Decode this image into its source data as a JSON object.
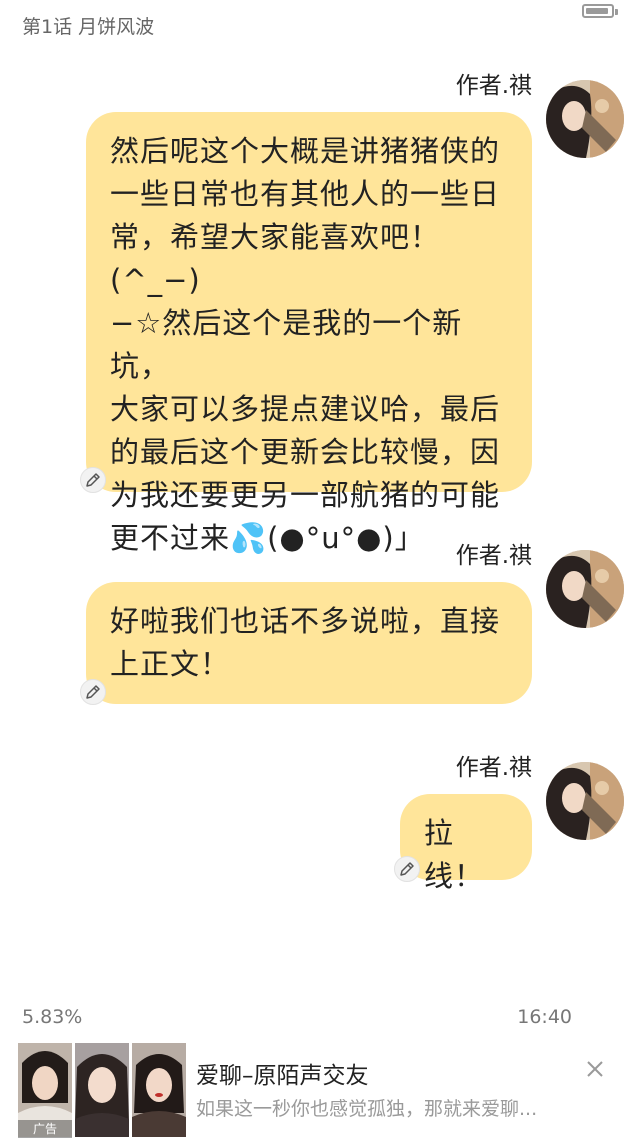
{
  "chapter": {
    "title": "第1话 月饼风波"
  },
  "messages": [
    {
      "author": "作者.祺",
      "lines": [
        "然后呢这个大概是讲猪猪侠的",
        "一些日常也有其他人的一些日",
        "常，希望大家能喜欢吧！(^_−)",
        "−☆然后这个是我的一个新坑，",
        "大家可以多提点建议哈，最后",
        "的最后这个更新会比较慢，因",
        "为我还要更另一部航猪的可能",
        "更不过来💦(●°u°●)」"
      ]
    },
    {
      "author": "作者.祺",
      "lines": [
        "好啦我们也话不多说啦，直接",
        "上正文！"
      ]
    },
    {
      "author": "作者.祺",
      "lines": [
        "拉线！"
      ]
    }
  ],
  "status": {
    "progress": "5.83%",
    "time": "16:40",
    "battery_level": 0.9
  },
  "ad": {
    "title": "爱聊–原陌声交友",
    "description": "如果这一秒你也感觉孤独，那就来爱聊...",
    "tag": "广告"
  },
  "colors": {
    "bubble": "#ffe59a",
    "page_background": "#ffffff"
  },
  "icons": {
    "edit": "pencil-icon",
    "close": "close-icon"
  }
}
